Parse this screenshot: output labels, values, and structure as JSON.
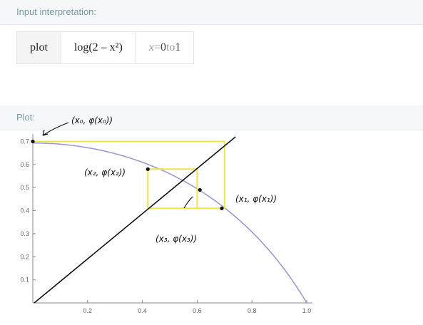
{
  "interpretation": {
    "header": "Input interpretation:",
    "command": "plot",
    "expression": "log(2 – x²)",
    "range_var": "x",
    "range_eq": " = ",
    "range_start": "0",
    "range_to": " to ",
    "range_end": "1"
  },
  "plot": {
    "header": "Plot:",
    "annotations": {
      "a0": "(x₀, φ(x₀))",
      "a1": "(x₁, φ(x₁))",
      "a2": "(x₂, φ(x₂))",
      "a3": "(x₃, φ(x₃))"
    }
  },
  "chart_data": {
    "type": "line",
    "title": "",
    "xlabel": "",
    "ylabel": "",
    "xlim": [
      0,
      1
    ],
    "ylim": [
      0,
      0.72
    ],
    "x_ticks": [
      "0.2",
      "0.4",
      "0.6",
      "0.8",
      "1.0"
    ],
    "y_ticks": [
      "0.1",
      "0.2",
      "0.3",
      "0.4",
      "0.5",
      "0.6",
      "0.7"
    ],
    "x_tick_values": [
      0.2,
      0.4,
      0.6,
      0.8,
      1.0
    ],
    "y_tick_values": [
      0.1,
      0.2,
      0.3,
      0.4,
      0.5,
      0.6,
      0.7
    ],
    "series": [
      {
        "function": "log(2 - x^2)",
        "color": "#9a9ad6",
        "x": [
          0,
          0.1,
          0.2,
          0.3,
          0.4,
          0.5,
          0.6,
          0.7,
          0.8,
          0.9,
          1.0
        ],
        "y": [
          0.693,
          0.688,
          0.673,
          0.648,
          0.611,
          0.56,
          0.495,
          0.412,
          0.307,
          0.175,
          0.0
        ]
      }
    ],
    "hand_drawn": {
      "diagonal_color": "#111111",
      "diagonal_x": [
        0.0,
        0.74
      ],
      "diagonal_y": [
        0.0,
        0.72
      ],
      "cobweb_color": "#f2e34b",
      "cobweb_x": [
        0.0,
        0.7,
        0.7,
        0.42,
        0.42,
        0.6,
        0.6
      ],
      "cobweb_y": [
        0.7,
        0.7,
        0.41,
        0.41,
        0.58,
        0.58,
        0.41
      ],
      "points_x": [
        0.0,
        0.69,
        0.42,
        0.61
      ],
      "points_y": [
        0.7,
        0.41,
        0.58,
        0.49
      ]
    }
  }
}
